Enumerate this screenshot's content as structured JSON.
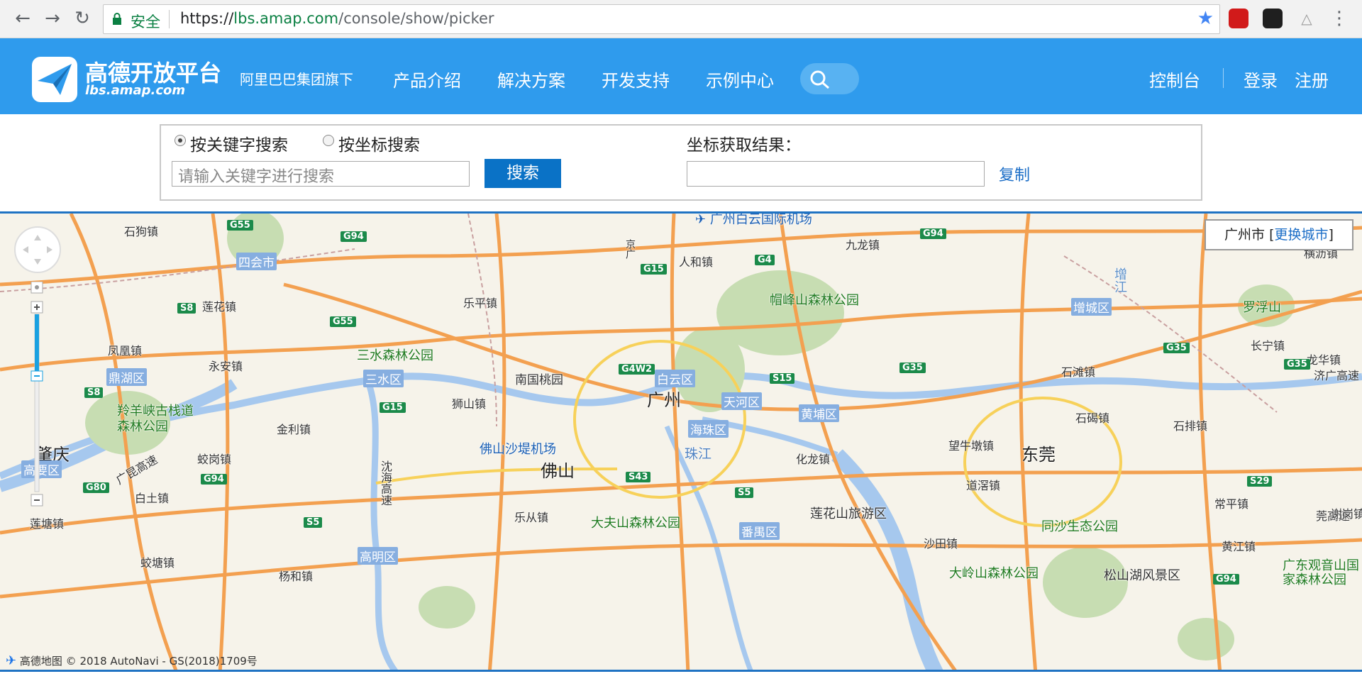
{
  "browser": {
    "secure_text": "安全",
    "url_scheme": "https://",
    "url_host": "lbs.amap.com",
    "url_path": "/console/show/picker"
  },
  "header": {
    "logo_title": "高德开放平台",
    "logo_sub": "lbs.amap.com",
    "group": "阿里巴巴集团旗下",
    "nav": [
      "产品介绍",
      "解决方案",
      "开发支持",
      "示例中心"
    ],
    "console": "控制台",
    "login": "登录",
    "register": "注册"
  },
  "picker": {
    "radio_keyword": "按关键字搜索",
    "radio_coord": "按坐标搜索",
    "keyword_placeholder": "请输入关键字进行搜索",
    "search_button": "搜索",
    "result_label": "坐标获取结果：",
    "result_value": "",
    "copy": "复制"
  },
  "map": {
    "city": "广州市",
    "change_city": "更换城市",
    "attribution_logo": "高德地图",
    "attribution": "© 2018 AutoNavi - GS(2018)1709号",
    "labels": {
      "airport_baiyun": "广州白云国际机场",
      "shigouzhen": "石狗镇",
      "jiulongzhen": "九龙镇",
      "renhezhen": "人和镇",
      "maofengshan": "帽峰山森林公园",
      "zengjiang": "增江",
      "luofushan": "罗浮山",
      "henglizhen": "横沥镇",
      "sihuishi": "四会市",
      "jingcheng": "京广",
      "lianhuazhen": "莲花镇",
      "lepingzhen": "乐平镇",
      "zengcheng": "增城区",
      "fenghuangzhen": "凤凰镇",
      "yonganzhen": "永安镇",
      "sanshui_park": "三水森林公园",
      "nanguotaoyuan": "南国桃园",
      "changningzhen": "长宁镇",
      "longhuazhen": "龙华镇",
      "jiguang": "济广高速",
      "shitanzhen": "石滩镇",
      "dinghuqu": "鼎湖区",
      "sanshuiqu": "三水区",
      "baiyunqu": "白云区",
      "guangzhou": "广州",
      "tianhequ": "天河区",
      "huangpuqu": "黄埔区",
      "lingyangxia": "羚羊峡古栈道森林公园",
      "shishanzhen": "狮山镇",
      "shijiezhen": "石碣镇",
      "shipaizhen": "石排镇",
      "jinlizhen": "金利镇",
      "foshan_airport": "佛山沙堤机场",
      "haizhuqu": "海珠区",
      "zhaoqing": "肇庆",
      "gaoyaoqu": "高要区",
      "zhujiang": "珠江",
      "wangniudun": "望牛墩镇",
      "dongguan": "东莞",
      "jiaogangzhen": "蛟岗镇",
      "foshan": "佛山",
      "huaruzhen": "化龙镇",
      "guangkun": "广昆高速",
      "shenhai": "沈海高速",
      "baituzhen": "白土镇",
      "daojiaozhen": "道滘镇",
      "changpingzhen": "常平镇",
      "lecongzhen": "乐从镇",
      "dafushan": "大夫山森林公园",
      "lianhuashan": "莲花山旅游区",
      "tongsha": "同沙生态公园",
      "lianguzhen": "莲塘镇",
      "panyuqu": "番禺区",
      "huangjiangzhen": "黄江镇",
      "qishizhen": "沙田镇",
      "jiaotangzhen": "蛟塘镇",
      "gaomingqu": "高明区",
      "yangheizhen": "杨和镇",
      "daling": "大岭山森林公园",
      "songshanhu": "松山湖风景区",
      "guanyinshan": "广东观音山国家森林公园",
      "guanhu": "莞高速",
      "shiqizhen": "谢岗镇"
    },
    "shields": [
      "G55",
      "G94",
      "G15",
      "G4",
      "G94",
      "S8",
      "G55",
      "G4W2",
      "S15",
      "G35",
      "G35",
      "G35",
      "S8",
      "G15",
      "S43",
      "S5",
      "G94",
      "G80",
      "S5",
      "S29",
      "G94"
    ]
  }
}
